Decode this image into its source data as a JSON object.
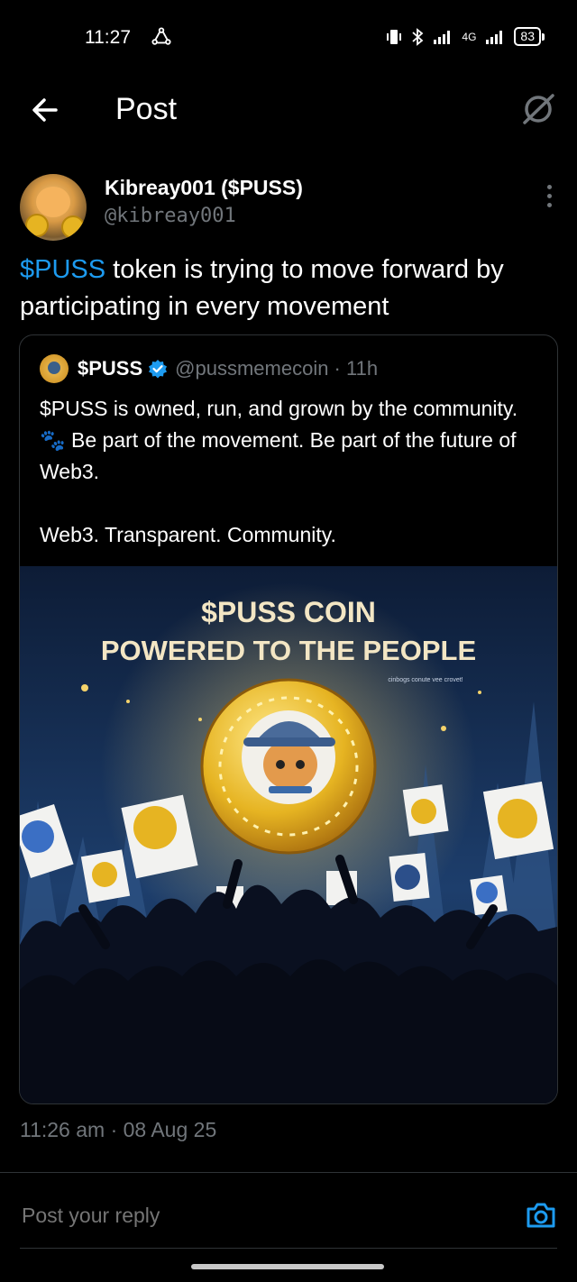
{
  "status_bar": {
    "time": "11:27",
    "network": "4G",
    "battery": "83"
  },
  "header": {
    "title": "Post",
    "back_icon": "arrow-left-icon",
    "grok_icon": "grok-icon"
  },
  "post": {
    "author_name": "Kibreay001 ($PUSS)",
    "author_handle": "@kibreay001",
    "text_cashtag": "$PUSS",
    "text_rest": " token is trying to move forward by participating in every movement",
    "timestamp": "11:26 am · 08 Aug 25"
  },
  "quote": {
    "name": "$PUSS",
    "handle_time": "@pussmemecoin · 11h",
    "text_part1": "$PUSS is owned, run, and grown by the community. ",
    "paw": "🐾",
    "text_part2": " Be part of the movement. Be part of the future of Web3.\n\nWeb3. Transparent. Community.",
    "image": {
      "headline_1": "$PUSS COIN",
      "headline_2": "POWERED TO THE PEOPLE",
      "small_caption": "cinbogs conute vee crovet!"
    }
  },
  "reply": {
    "placeholder": "Post your reply"
  },
  "colors": {
    "accent": "#1d9bf0",
    "muted": "#71767b",
    "background": "#000000"
  }
}
